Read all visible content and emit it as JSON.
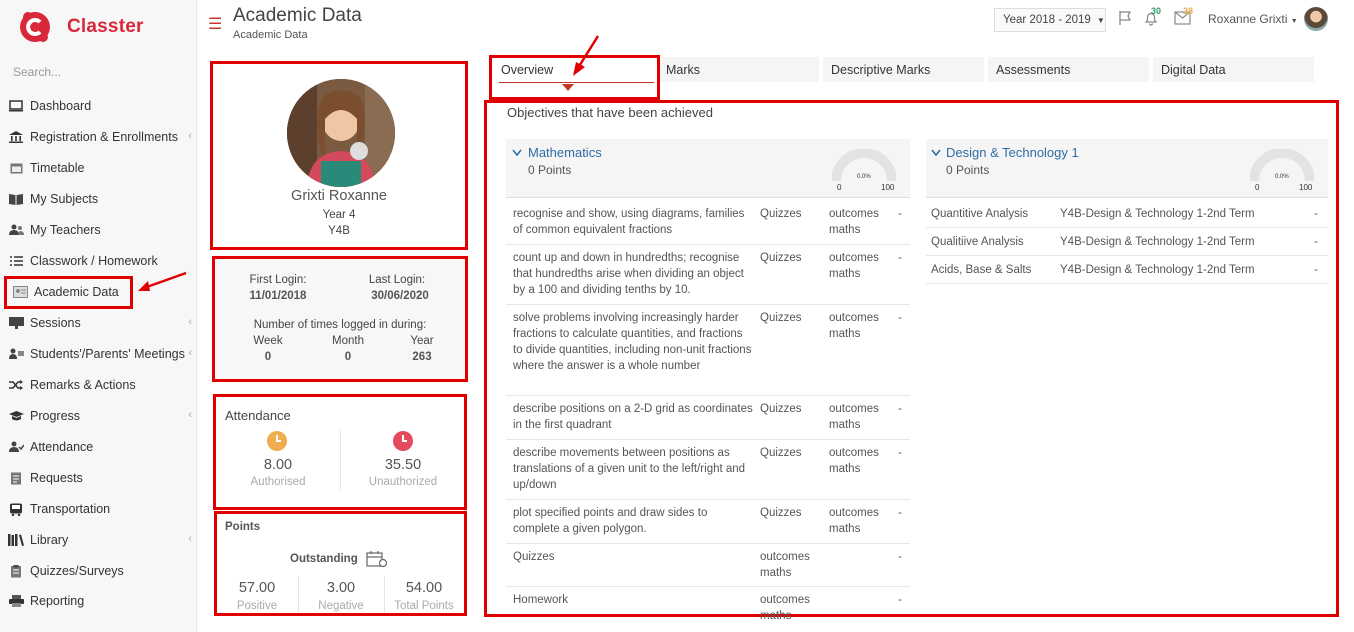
{
  "app": {
    "name": "Classter"
  },
  "sidebar": {
    "search_placeholder": "Search...",
    "items": [
      {
        "label": "Dashboard",
        "icon": "monitor-icon"
      },
      {
        "label": "Registration & Enrollments",
        "icon": "bank-icon",
        "chevron": true
      },
      {
        "label": "Timetable",
        "icon": "calendar-icon"
      },
      {
        "label": "My Subjects",
        "icon": "book-icon"
      },
      {
        "label": "My Teachers",
        "icon": "users-icon"
      },
      {
        "label": "Classwork / Homework",
        "icon": "list-icon"
      },
      {
        "label": "Academic Data",
        "icon": "id-card-icon",
        "active": true
      },
      {
        "label": "Sessions",
        "icon": "presentation-icon",
        "chevron": true
      },
      {
        "label": "Students'/Parents' Meetings",
        "icon": "meeting-icon",
        "chevron": true
      },
      {
        "label": "Remarks & Actions",
        "icon": "shuffle-icon"
      },
      {
        "label": "Progress",
        "icon": "graduation-cap-icon",
        "chevron": true
      },
      {
        "label": "Attendance",
        "icon": "user-check-icon"
      },
      {
        "label": "Requests",
        "icon": "document-icon"
      },
      {
        "label": "Transportation",
        "icon": "bus-icon"
      },
      {
        "label": "Library",
        "icon": "library-icon",
        "chevron": true
      },
      {
        "label": "Quizzes/Surveys",
        "icon": "clipboard-icon"
      },
      {
        "label": "Reporting",
        "icon": "printer-icon"
      }
    ]
  },
  "header": {
    "title": "Academic Data",
    "breadcrumb": "Academic Data",
    "year_select": "Year 2018 - 2019",
    "notifications_count": "30",
    "messages_count": "28",
    "user_name": "Roxanne Grixti"
  },
  "profile": {
    "name": "Grixti Roxanne",
    "year": "Year 4",
    "class": "Y4B"
  },
  "login": {
    "first_label": "First Login:",
    "first_value": "11/01/2018",
    "last_label": "Last Login:",
    "last_value": "30/06/2020",
    "times_label": "Number of times logged in during:",
    "week_label": "Week",
    "week_value": "0",
    "month_label": "Month",
    "month_value": "0",
    "year_label": "Year",
    "year_value": "263"
  },
  "attendance": {
    "title": "Attendance",
    "authorised_value": "8.00",
    "authorised_label": "Authorised",
    "unauthorized_value": "35.50",
    "unauthorized_label": "Unauthorized"
  },
  "points": {
    "title": "Points",
    "outstanding_label": "Outstanding",
    "positive_value": "57.00",
    "positive_label": "Positive",
    "negative_value": "3.00",
    "negative_label": "Negative",
    "total_value": "54.00",
    "total_label": "Total Points"
  },
  "tabs": [
    "Overview",
    "Marks",
    "Descriptive Marks",
    "Assessments",
    "Digital Data"
  ],
  "objectives": {
    "heading": "Objectives that have been achieved",
    "math": {
      "title": "Mathematics",
      "points": "0 Points",
      "gauge_value": "0.0%",
      "gauge_min": "0",
      "gauge_max": "100",
      "gauge_fraction": 0,
      "rows": [
        {
          "desc": "recognise and show, using diagrams, families of common equivalent fractions",
          "type": "Quizzes",
          "cat": "outcomes maths",
          "val": "-"
        },
        {
          "desc": "count up and down in hundredths; recognise that hundredths arise when dividing an object by a 100 and dividing tenths by 10.",
          "type": "Quizzes",
          "cat": "outcomes maths",
          "val": "-"
        },
        {
          "desc": "solve problems involving increasingly harder fractions to calculate quantities, and fractions to divide quantities, including non-unit fractions where the answer is a whole number",
          "type": "Quizzes",
          "cat": "outcomes maths",
          "val": "-"
        },
        {
          "desc": "describe positions on a 2-D grid as coordinates in the first quadrant",
          "type": "Quizzes",
          "cat": "outcomes maths",
          "val": "-"
        },
        {
          "desc": "describe movements between positions as translations of a given unit to the left/right and up/down",
          "type": "Quizzes",
          "cat": "outcomes maths",
          "val": "-"
        },
        {
          "desc": "plot specified points and draw sides to complete a given polygon.",
          "type": "Quizzes",
          "cat": "outcomes maths",
          "val": "-"
        },
        {
          "desc": "Quizzes",
          "type": "outcomes maths",
          "cat": "",
          "val": "-"
        },
        {
          "desc": "Homework",
          "type": "outcomes maths",
          "cat": "",
          "val": "-"
        }
      ]
    },
    "design": {
      "title": "Design & Technology 1",
      "points": "0 Points",
      "gauge_value": "0.0%",
      "gauge_min": "0",
      "gauge_max": "100",
      "gauge_fraction": 0,
      "rows": [
        {
          "desc": "Quantitive Analysis",
          "term": "Y4B-Design & Technology 1-2nd Term",
          "val": "-"
        },
        {
          "desc": "Qualitiive Analysis",
          "term": "Y4B-Design & Technology 1-2nd Term",
          "val": "-"
        },
        {
          "desc": "Acids, Base & Salts",
          "term": "Y4B-Design & Technology 1-2nd Term",
          "val": "-"
        }
      ]
    }
  },
  "colors": {
    "brand": "#d9283a",
    "highlight": "#e00000",
    "link": "#2e6da4",
    "attendance_auth": "#f0ad4e",
    "attendance_unauth": "#e54b5e"
  }
}
